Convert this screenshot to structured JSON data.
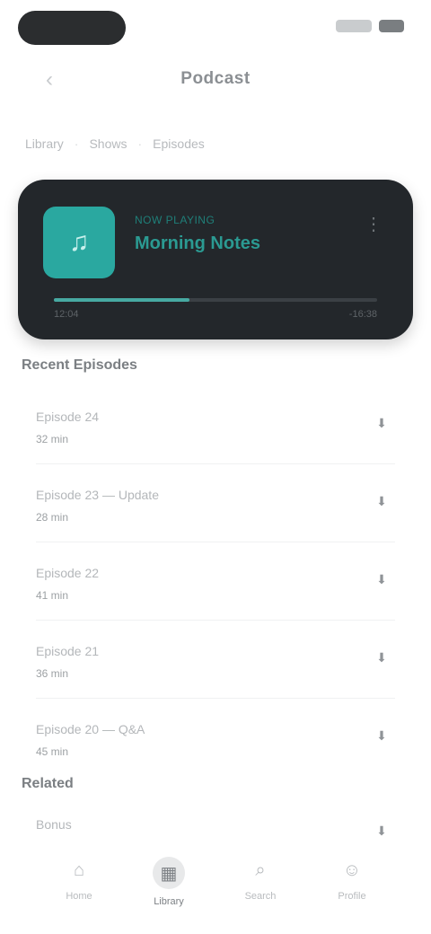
{
  "status_bar": {
    "time": ""
  },
  "header": {
    "title": "Podcast",
    "back_icon": "‹"
  },
  "breadcrumb": [
    "Library",
    "Shows",
    "Episodes"
  ],
  "player": {
    "label": "NOW PLAYING",
    "title": "Morning Notes",
    "avatar_icon": "♫",
    "more_icon": "⋮",
    "progress": 0.42,
    "elapsed": "12:04",
    "remaining": "-16:38"
  },
  "episodes_section": {
    "title": "Recent Episodes"
  },
  "episodes": [
    {
      "title": "Episode 24",
      "subtitle": "32 min",
      "action_icon": "⬇"
    },
    {
      "title": "Episode 23 — Update",
      "subtitle": "28 min",
      "action_icon": "⬇"
    },
    {
      "title": "Episode 22",
      "subtitle": "41 min",
      "action_icon": "⬇"
    },
    {
      "title": "Episode 21",
      "subtitle": "36 min",
      "action_icon": "⬇"
    },
    {
      "title": "Episode 20 — Q&A",
      "subtitle": "45 min",
      "action_icon": "⬇"
    }
  ],
  "more_section": {
    "title": "Related"
  },
  "related": [
    {
      "title": "Bonus",
      "subtitle": "",
      "action_icon": "⬇"
    }
  ],
  "bottom_nav": [
    {
      "label": "Home",
      "icon": "⌂",
      "active": false
    },
    {
      "label": "Library",
      "icon": "▦",
      "active": true
    },
    {
      "label": "Search",
      "icon": "⌕",
      "active": false
    },
    {
      "label": "Profile",
      "icon": "☺",
      "active": false
    }
  ],
  "colors": {
    "accent": "#2aa8a0",
    "card_bg": "#23272b"
  }
}
